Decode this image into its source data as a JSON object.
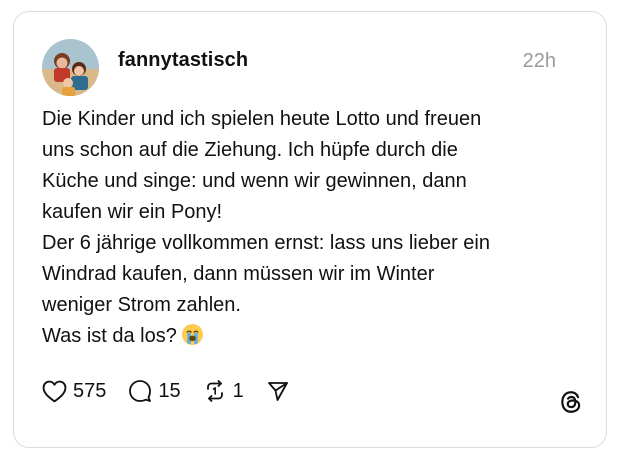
{
  "post": {
    "username": "fannytastisch",
    "timestamp": "22h",
    "lines": [
      "Die Kinder und ich spielen heute Lotto und freuen",
      "uns schon auf die Ziehung. Ich hüpfe durch die",
      "Küche und singe: und wenn wir gewinnen, dann",
      "kaufen wir ein Pony!",
      "Der 6 jährige vollkommen ernst: lass uns lieber ein",
      "Windrad kaufen, dann müssen wir im Winter",
      "weniger Strom zahlen.",
      "Was ist da los?"
    ],
    "emoji": "crying-face-emoji"
  },
  "actions": {
    "likes": "575",
    "replies": "15",
    "reposts": "1"
  },
  "icons": {
    "like": "heart-icon",
    "reply": "comment-bubble-icon",
    "repost": "repost-icon",
    "share": "send-icon",
    "brand": "threads-logo-icon"
  },
  "colors": {
    "text": "#111111",
    "muted": "#9a9a9a",
    "border": "#dcdcdc"
  }
}
